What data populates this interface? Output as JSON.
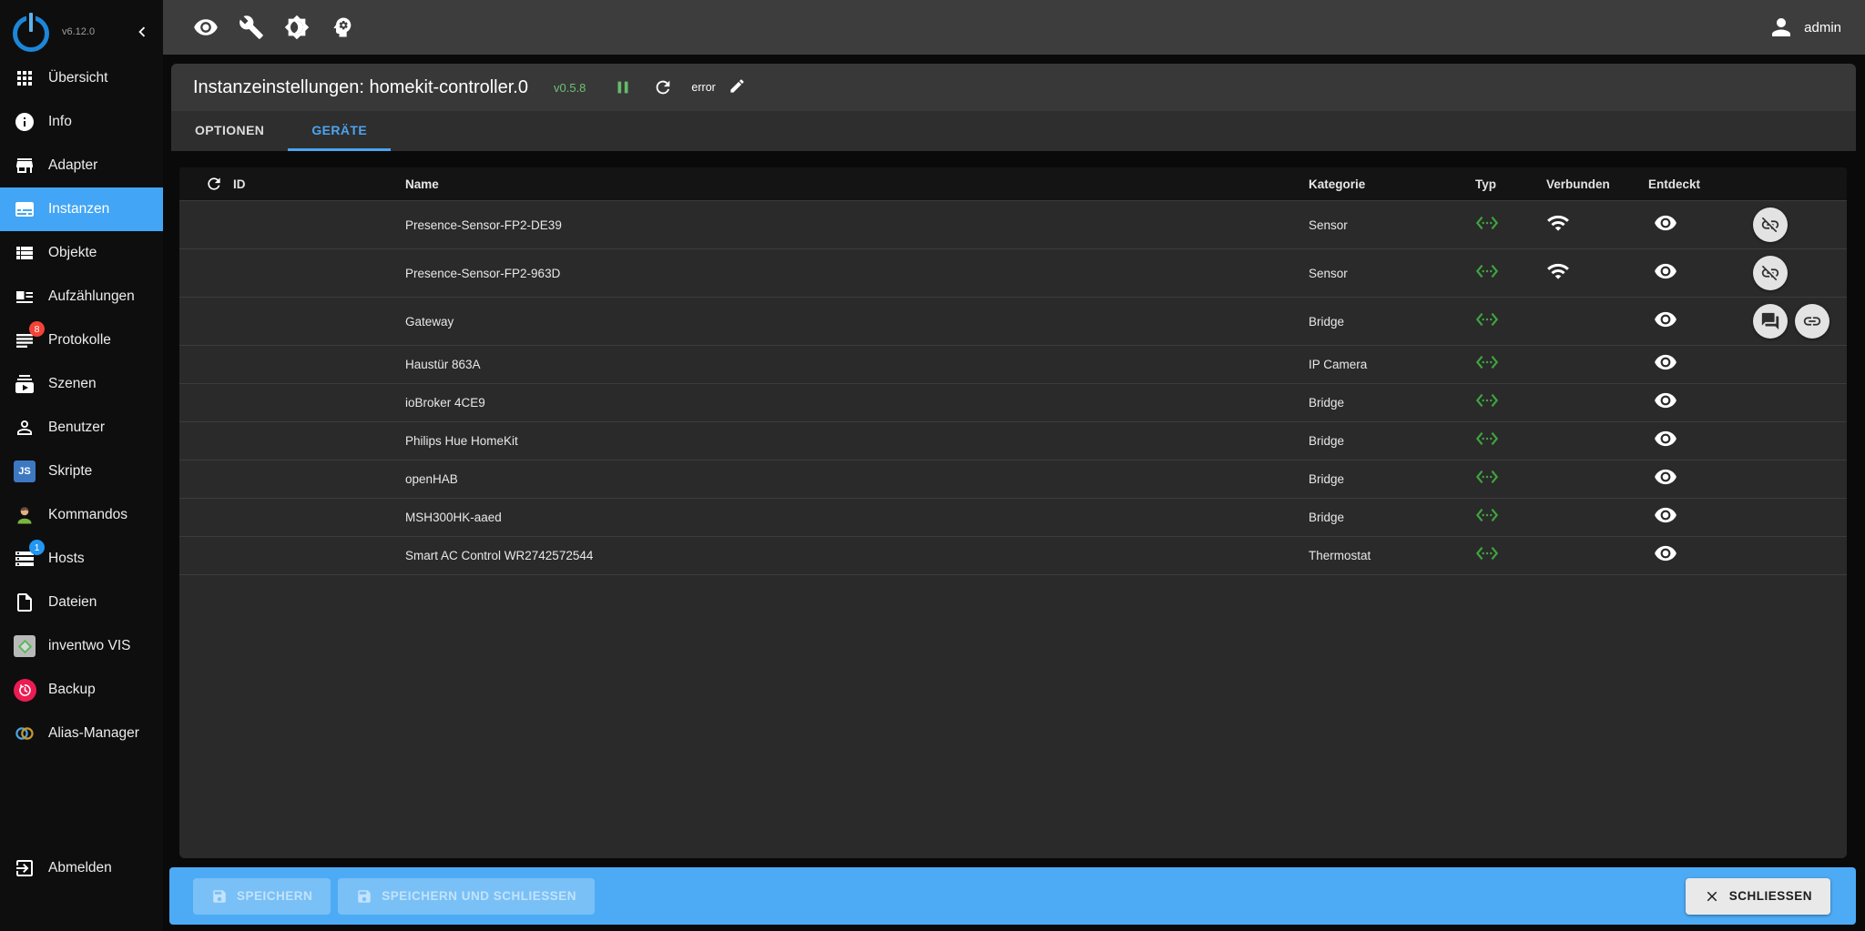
{
  "app": {
    "version": "v6.12.0"
  },
  "toolbar": {
    "icons": [
      {
        "name": "visibility"
      },
      {
        "name": "build-wrench"
      },
      {
        "name": "theme-toggle"
      },
      {
        "name": "expert-mode"
      }
    ],
    "user": "admin"
  },
  "sidebar": {
    "items": [
      {
        "id": "uebersicht",
        "label": "Übersicht",
        "icon": "apps",
        "active": false
      },
      {
        "id": "info",
        "label": "Info",
        "icon": "info",
        "active": false
      },
      {
        "id": "adapter",
        "label": "Adapter",
        "icon": "store",
        "active": false
      },
      {
        "id": "instanzen",
        "label": "Instanzen",
        "icon": "subtitles",
        "active": true
      },
      {
        "id": "objekte",
        "label": "Objekte",
        "icon": "viewlist",
        "active": false
      },
      {
        "id": "aufzaehlungen",
        "label": "Aufzählungen",
        "icon": "enums",
        "active": false
      },
      {
        "id": "protokolle",
        "label": "Protokolle",
        "icon": "logs",
        "active": false,
        "badge": "8",
        "badge_color": "#f44336"
      },
      {
        "id": "szenen",
        "label": "Szenen",
        "icon": "subscriptions",
        "active": false
      },
      {
        "id": "benutzer",
        "label": "Benutzer",
        "icon": "person-outline",
        "active": false
      },
      {
        "id": "skripte",
        "label": "Skripte",
        "icon": "javascript",
        "active": false
      },
      {
        "id": "kommandos",
        "label": "Kommandos",
        "icon": "avatar",
        "active": false
      },
      {
        "id": "hosts",
        "label": "Hosts",
        "icon": "storage",
        "active": false,
        "badge": "1",
        "badge_color": "#2196f3"
      },
      {
        "id": "dateien",
        "label": "Dateien",
        "icon": "file",
        "active": false
      },
      {
        "id": "inventwo-vis",
        "label": "inventwo VIS",
        "icon": "vis",
        "active": false
      },
      {
        "id": "backup",
        "label": "Backup",
        "icon": "backup",
        "active": false
      },
      {
        "id": "alias-manager",
        "label": "Alias-Manager",
        "icon": "alias",
        "active": false
      }
    ],
    "logout": "Abmelden"
  },
  "dialog": {
    "title": "Instanzeinstellungen: homekit-controller.0",
    "adapter_version": "v0.5.8",
    "log_level": "error",
    "tabs": [
      {
        "label": "OPTIONEN",
        "active": false
      },
      {
        "label": "GERÄTE",
        "active": true
      }
    ],
    "table": {
      "headers": {
        "id": "ID",
        "name": "Name",
        "kategorie": "Kategorie",
        "typ": "Typ",
        "verbunden": "Verbunden",
        "entdeckt": "Entdeckt"
      },
      "rows": [
        {
          "id": "",
          "name": "Presence-Sensor-FP2-DE39",
          "kategorie": "Sensor",
          "typ_icon": "settings-ethernet",
          "connected": true,
          "discovered": true,
          "actions": [
            "unlink"
          ]
        },
        {
          "id": "",
          "name": "Presence-Sensor-FP2-963D",
          "kategorie": "Sensor",
          "typ_icon": "settings-ethernet",
          "connected": true,
          "discovered": true,
          "actions": [
            "unlink"
          ]
        },
        {
          "id": "",
          "name": "Gateway",
          "kategorie": "Bridge",
          "typ_icon": "settings-ethernet",
          "connected": false,
          "discovered": true,
          "actions": [
            "forum",
            "link"
          ]
        },
        {
          "id": "",
          "name": "Haustür 863A",
          "kategorie": "IP Camera",
          "typ_icon": "settings-ethernet",
          "connected": false,
          "discovered": true,
          "actions": []
        },
        {
          "id": "",
          "name": "ioBroker 4CE9",
          "kategorie": "Bridge",
          "typ_icon": "settings-ethernet",
          "connected": false,
          "discovered": true,
          "actions": []
        },
        {
          "id": "",
          "name": "Philips Hue HomeKit",
          "kategorie": "Bridge",
          "typ_icon": "settings-ethernet",
          "connected": false,
          "discovered": true,
          "actions": []
        },
        {
          "id": "",
          "name": "openHAB",
          "kategorie": "Bridge",
          "typ_icon": "settings-ethernet",
          "connected": false,
          "discovered": true,
          "actions": []
        },
        {
          "id": "",
          "name": "MSH300HK-aaed",
          "kategorie": "Bridge",
          "typ_icon": "settings-ethernet",
          "connected": false,
          "discovered": true,
          "actions": []
        },
        {
          "id": "",
          "name": "Smart AC Control WR2742572544",
          "kategorie": "Thermostat",
          "typ_icon": "settings-ethernet",
          "connected": false,
          "discovered": true,
          "actions": []
        }
      ]
    },
    "footer": {
      "save": "SPEICHERN",
      "save_and_close": "SPEICHERN UND SCHLIESSEN",
      "close": "SCHLIESSEN",
      "save_enabled": false
    }
  },
  "colors": {
    "sidebar_active": "#42a5f5",
    "footer_bar": "#4dabf5",
    "tab_active": "#4da3f0",
    "typ_green": "#3fa33f",
    "badge_red": "#f44336",
    "badge_blue": "#2196f3",
    "adapter_version_green": "#6fbf73"
  }
}
